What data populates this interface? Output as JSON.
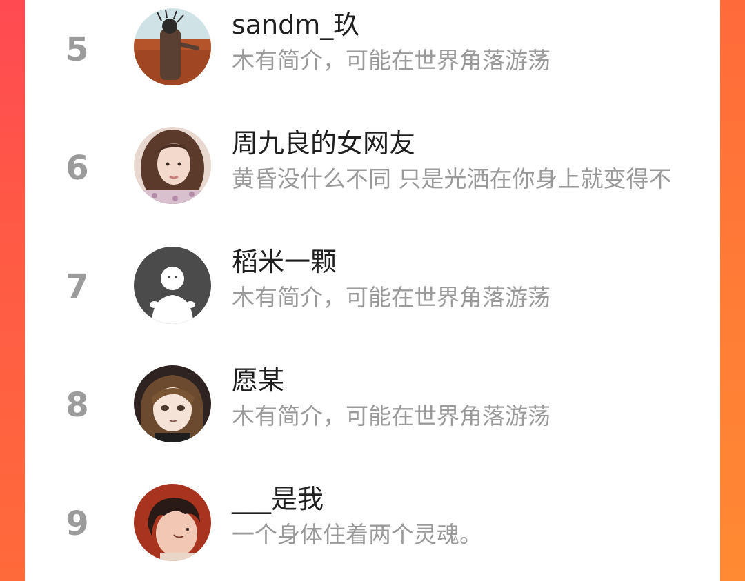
{
  "users": [
    {
      "rank": "5",
      "name": "sandm_玖",
      "bio": "木有简介，可能在世界角落游荡",
      "avatar_icon": "user-avatar-field-photo"
    },
    {
      "rank": "6",
      "name": "周九良的女网友",
      "bio": "黄昏没什么不同 只是光洒在你身上就变得不",
      "avatar_icon": "user-avatar-girl-photo"
    },
    {
      "rank": "7",
      "name": "稻米一颗",
      "bio": "木有简介，可能在世界角落游荡",
      "avatar_icon": "default-avatar-icon"
    },
    {
      "rank": "8",
      "name": "愿某",
      "bio": "木有简介，可能在世界角落游荡",
      "avatar_icon": "user-avatar-anime"
    },
    {
      "rank": "9",
      "name": "___是我",
      "bio": "一个身体住着两个灵魂。",
      "avatar_icon": "user-avatar-illustration"
    }
  ],
  "colors": {
    "frame_left": "#ff4a52",
    "frame_right": "#ff8a33",
    "rank": "#9b9b9b",
    "name": "#1f1f1f",
    "bio": "#9a9a9a"
  }
}
